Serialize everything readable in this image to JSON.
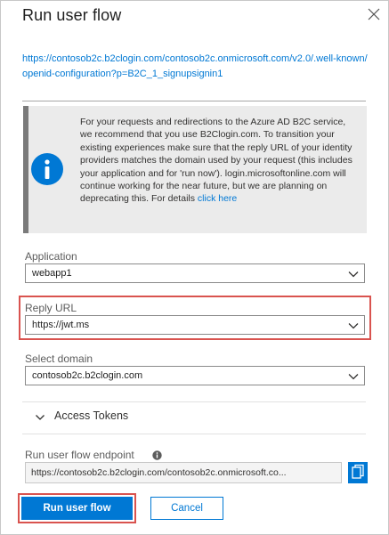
{
  "panel": {
    "title": "Run user flow"
  },
  "metadata_url": "https://contosob2c.b2clogin.com/contosob2c.onmicrosoft.com/v2.0/.well-known/openid-configuration?p=B2C_1_signupsignin1",
  "notice": {
    "text": "For your requests and redirections to the Azure AD B2C service, we recommend that you use B2Clogin.com. To transition your existing experiences make sure that the reply URL of your identity providers matches the domain used by your request (this includes your application and for 'run now'). login.microsoftonline.com will continue working for the near future, but we are planning on deprecating this. For details ",
    "link": "click here",
    "icon": "info-icon"
  },
  "form": {
    "application": {
      "label": "Application",
      "value": "webapp1"
    },
    "reply_url": {
      "label": "Reply URL",
      "value": "https://jwt.ms"
    },
    "select_domain": {
      "label": "Select domain",
      "value": "contosob2c.b2clogin.com"
    },
    "access_tokens": {
      "label": "Access Tokens"
    },
    "endpoint": {
      "label": "Run user flow endpoint",
      "value": "https://contosob2c.b2clogin.com/contosob2c.onmicrosoft.co..."
    }
  },
  "actions": {
    "run_label": "Run user flow",
    "cancel_label": "Cancel"
  },
  "colors": {
    "accent": "#0078d4",
    "highlight": "#d9534f"
  }
}
